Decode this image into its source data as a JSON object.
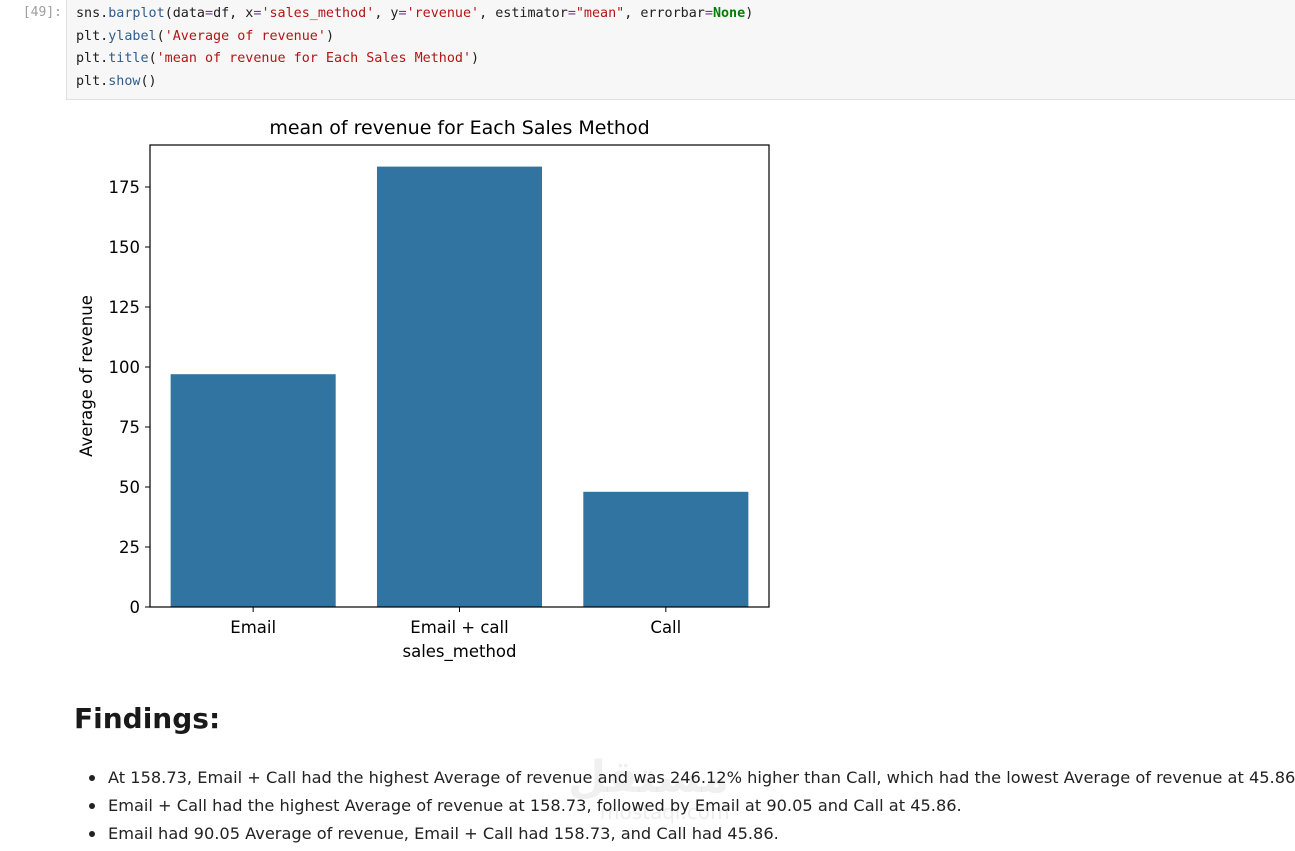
{
  "cell": {
    "prompt": "[49]:",
    "code_lines": [
      [
        {
          "t": "sns.",
          "c": ""
        },
        {
          "t": "barplot",
          "c": "fn"
        },
        {
          "t": "(data",
          "c": ""
        },
        {
          "t": "=",
          "c": "op"
        },
        {
          "t": "df, x",
          "c": ""
        },
        {
          "t": "=",
          "c": "op"
        },
        {
          "t": "'sales_method'",
          "c": "str"
        },
        {
          "t": ", y",
          "c": ""
        },
        {
          "t": "=",
          "c": "op"
        },
        {
          "t": "'revenue'",
          "c": "str"
        },
        {
          "t": ", estimator",
          "c": ""
        },
        {
          "t": "=",
          "c": "op"
        },
        {
          "t": "\"mean\"",
          "c": "str"
        },
        {
          "t": ", errorbar",
          "c": ""
        },
        {
          "t": "=",
          "c": "op"
        },
        {
          "t": "None",
          "c": "kw"
        },
        {
          "t": ")",
          "c": ""
        }
      ],
      [
        {
          "t": "plt.",
          "c": ""
        },
        {
          "t": "ylabel",
          "c": "fn"
        },
        {
          "t": "(",
          "c": ""
        },
        {
          "t": "'Average of revenue'",
          "c": "str"
        },
        {
          "t": ")",
          "c": ""
        }
      ],
      [
        {
          "t": "plt.",
          "c": ""
        },
        {
          "t": "title",
          "c": "fn"
        },
        {
          "t": "(",
          "c": ""
        },
        {
          "t": "'mean of revenue for Each Sales Method'",
          "c": "str"
        },
        {
          "t": ")",
          "c": ""
        }
      ],
      [
        {
          "t": "plt.",
          "c": ""
        },
        {
          "t": "show",
          "c": "fn"
        },
        {
          "t": "()",
          "c": ""
        }
      ]
    ]
  },
  "chart_data": {
    "type": "bar",
    "title": "mean of revenue for Each Sales Method",
    "xlabel": "sales_method",
    "ylabel": "Average of revenue",
    "categories": [
      "Email",
      "Email + call",
      "Call"
    ],
    "values": [
      97,
      183.5,
      48
    ],
    "ylim": [
      0,
      192.5
    ],
    "yticks": [
      0,
      25,
      50,
      75,
      100,
      125,
      150,
      175
    ],
    "bar_color": "#3274a1",
    "grid": false
  },
  "findings": {
    "title": "Findings:",
    "items": [
      "At 158.73, Email + Call had the highest Average of revenue and was 246.12% higher than Call, which had the lowest Average of revenue at 45.86",
      "Email + Call had the highest Average of revenue at 158.73, followed by Email at 90.05 and Call at 45.86.",
      "Email had 90.05 Average of revenue, Email + Call had 158.73, and Call had 45.86."
    ]
  },
  "watermark": {
    "text": "مستقل",
    "sub": "mostaql.com"
  }
}
